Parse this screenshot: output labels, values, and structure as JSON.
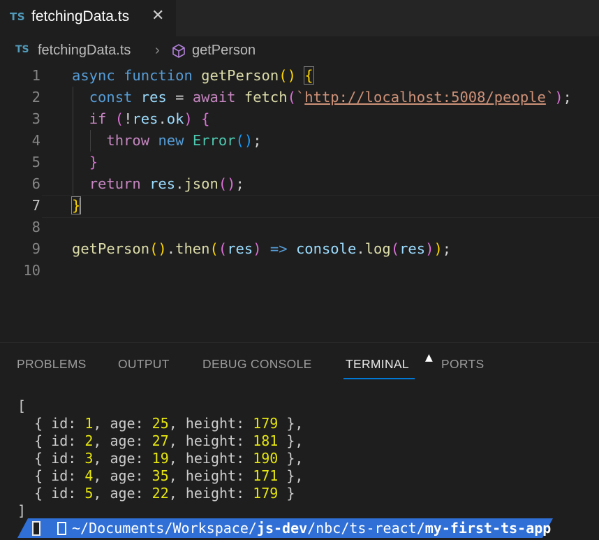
{
  "tab": {
    "lang_badge": "TS",
    "filename": "fetchingData.ts",
    "close_glyph": "✕"
  },
  "breadcrumb": {
    "lang_badge": "TS",
    "file": "fetchingData.ts",
    "separator": "›",
    "symbol": "getPerson"
  },
  "editor": {
    "line_numbers": [
      "1",
      "2",
      "3",
      "4",
      "5",
      "6",
      "7",
      "8",
      "9",
      "10"
    ],
    "active_line": "7",
    "lines": [
      [
        {
          "t": "async ",
          "c": "kw"
        },
        {
          "t": "function ",
          "c": "kw"
        },
        {
          "t": "getPerson",
          "c": "fn"
        },
        {
          "t": "() ",
          "c": "b1"
        },
        {
          "t": "{",
          "c": "b1 bmatch"
        }
      ],
      [
        {
          "t": "  "
        },
        {
          "t": "const ",
          "c": "kw"
        },
        {
          "t": "res",
          "c": "var"
        },
        {
          "t": " = "
        },
        {
          "t": "await ",
          "c": "ctl"
        },
        {
          "t": "fetch",
          "c": "fn"
        },
        {
          "t": "(",
          "c": "b2"
        },
        {
          "t": "`",
          "c": "str"
        },
        {
          "t": "http://localhost:5008/people",
          "c": "url"
        },
        {
          "t": "`",
          "c": "str"
        },
        {
          "t": ")",
          "c": "b2"
        },
        {
          "t": ";"
        }
      ],
      [
        {
          "t": "  "
        },
        {
          "t": "if ",
          "c": "ctl"
        },
        {
          "t": "(",
          "c": "b2"
        },
        {
          "t": "!"
        },
        {
          "t": "res",
          "c": "var"
        },
        {
          "t": "."
        },
        {
          "t": "ok",
          "c": "var"
        },
        {
          "t": ") ",
          "c": "b2"
        },
        {
          "t": "{",
          "c": "b2"
        }
      ],
      [
        {
          "t": "    "
        },
        {
          "t": "throw ",
          "c": "ctl"
        },
        {
          "t": "new ",
          "c": "kw"
        },
        {
          "t": "Error",
          "c": "cls"
        },
        {
          "t": "()",
          "c": "b3"
        },
        {
          "t": ";"
        }
      ],
      [
        {
          "t": "  "
        },
        {
          "t": "}",
          "c": "b2"
        }
      ],
      [
        {
          "t": "  "
        },
        {
          "t": "return ",
          "c": "ctl"
        },
        {
          "t": "res",
          "c": "var"
        },
        {
          "t": "."
        },
        {
          "t": "json",
          "c": "fn"
        },
        {
          "t": "()",
          "c": "b2"
        },
        {
          "t": ";"
        }
      ],
      [
        {
          "t": "}",
          "c": "b1 bmatch"
        },
        {
          "cursor": true
        }
      ],
      [],
      [
        {
          "t": "getPerson",
          "c": "fn"
        },
        {
          "t": "()",
          "c": "b1"
        },
        {
          "t": "."
        },
        {
          "t": "then",
          "c": "fn"
        },
        {
          "t": "(",
          "c": "b1"
        },
        {
          "t": "(",
          "c": "b2"
        },
        {
          "t": "res",
          "c": "var"
        },
        {
          "t": ")",
          "c": "b2"
        },
        {
          "t": " => ",
          "c": "kw"
        },
        {
          "t": "console",
          "c": "var"
        },
        {
          "t": "."
        },
        {
          "t": "log",
          "c": "fn"
        },
        {
          "t": "(",
          "c": "b2"
        },
        {
          "t": "res",
          "c": "var"
        },
        {
          "t": ")",
          "c": "b2"
        },
        {
          "t": ")",
          "c": "b1"
        },
        {
          "t": ";"
        }
      ],
      []
    ]
  },
  "panel": {
    "tabs": [
      {
        "label": "PROBLEMS",
        "active": false
      },
      {
        "label": "OUTPUT",
        "active": false
      },
      {
        "label": "DEBUG CONSOLE",
        "active": false
      },
      {
        "label": "TERMINAL",
        "active": true
      },
      {
        "label": "PORTS",
        "active": false
      }
    ]
  },
  "terminal": {
    "open_bracket": "[",
    "records": [
      {
        "id": "1",
        "age": "25",
        "height": "179",
        "trail": " },"
      },
      {
        "id": "2",
        "age": "27",
        "height": "181",
        "trail": " },"
      },
      {
        "id": "3",
        "age": "19",
        "height": "190",
        "trail": " },"
      },
      {
        "id": "4",
        "age": "35",
        "height": "171",
        "trail": " },"
      },
      {
        "id": "5",
        "age": "22",
        "height": "179",
        "trail": " }"
      }
    ],
    "close_bracket": "]",
    "prompt_path_plain_1": "~/Documents/Workspace/",
    "prompt_path_bold_1": "js-dev",
    "prompt_path_plain_2": "/nbc/ts-react/",
    "prompt_path_bold_2": "my-first-ts-app",
    "prompt_bg": "#2f6fd6",
    "prompt_segment_bg": "#e9e9e9"
  }
}
